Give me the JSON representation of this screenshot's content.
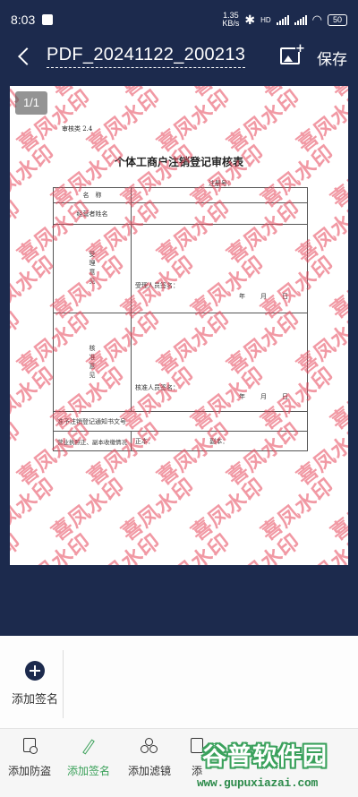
{
  "status_bar": {
    "time": "8:03",
    "net_speed_value": "1.35",
    "net_speed_unit": "KB/s",
    "network_type": "HD",
    "battery": "50"
  },
  "header": {
    "title": "PDF_20241122_200213",
    "save_label": "保存"
  },
  "document": {
    "page_indicator": "1/1",
    "form_number": "审核类 2.4",
    "form_title": "个体工商户注销登记审核表",
    "registration_label": "注册号：",
    "rows": {
      "name_label": "名　称",
      "operator_label": "经营者姓名",
      "accept_label": "受理意见",
      "accept_person": "受理人员签名：",
      "approve_label": "核准意见",
      "approve_person": "核准人员签名：",
      "date_text": "年　　月　　日",
      "notice_label": "准予注销登记通知书文号",
      "license_label": "营业执照正、副本收缴情况",
      "original_label": "正本：",
      "copy_label": "副本："
    },
    "watermark_text": "喜凤水印"
  },
  "signature_panel": {
    "add_signature_label": "添加签名"
  },
  "toolbar": {
    "items": [
      {
        "label": "添加防盗",
        "icon": "shield-doc-icon",
        "active": false
      },
      {
        "label": "添加签名",
        "icon": "pen-icon",
        "active": true
      },
      {
        "label": "添加滤镜",
        "icon": "filter-icon",
        "active": false
      },
      {
        "label": "添",
        "icon": "doc-icon",
        "active": false
      }
    ]
  },
  "promo": {
    "logo_text": "谷普软件园",
    "url": "www.gupuxiazai.com"
  },
  "colors": {
    "navy": "#1c2a4d",
    "accent_green": "#3ba15a",
    "watermark_red": "#e6465a"
  }
}
